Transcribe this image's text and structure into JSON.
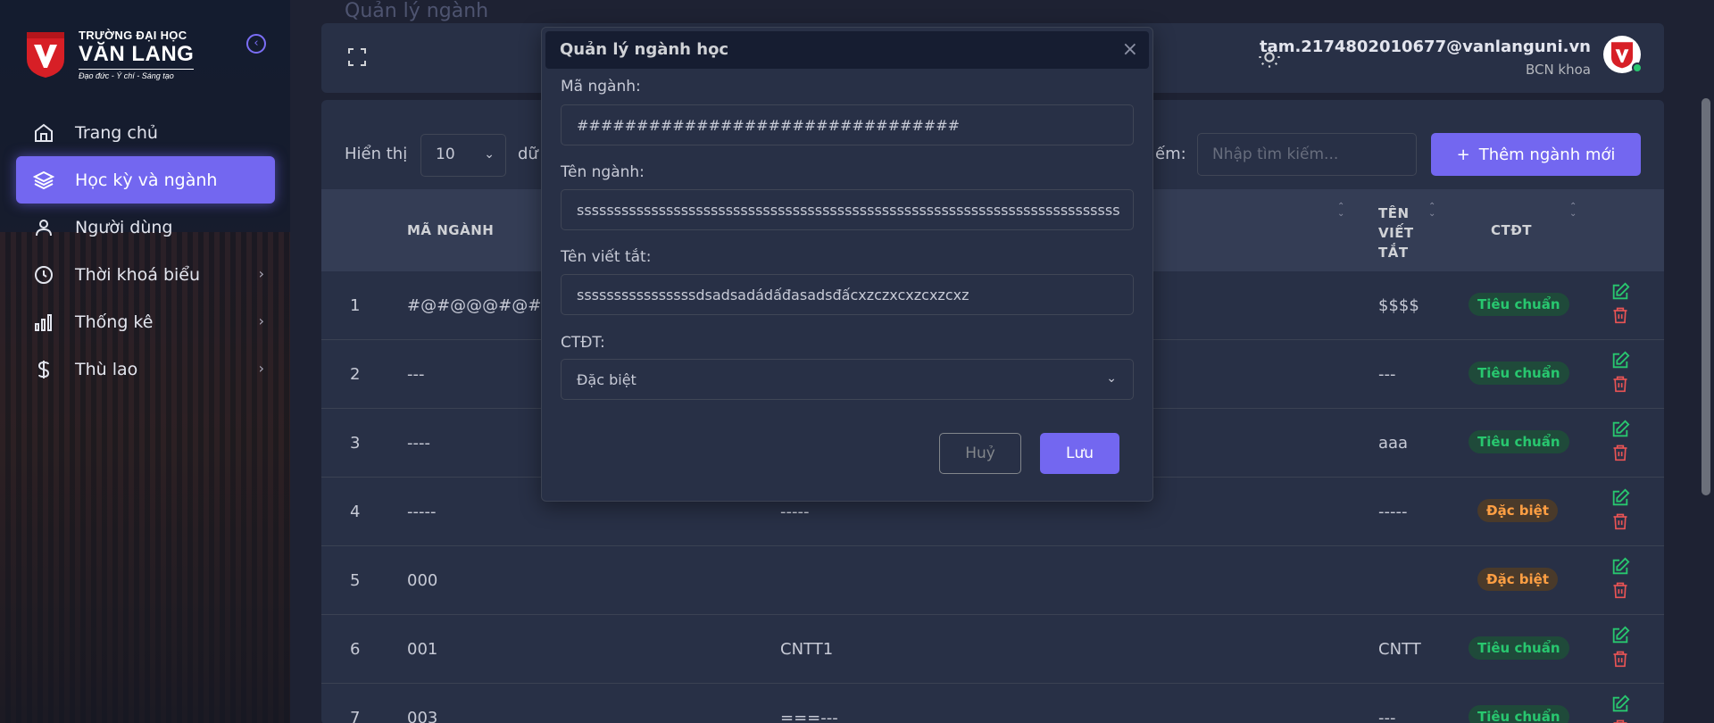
{
  "logo": {
    "line1": "TRƯỜNG ĐẠI HỌC",
    "line2": "VĂN LANG",
    "line3": "Đạo đức - Ý chí - Sáng tạo"
  },
  "sidebar": {
    "items": [
      {
        "label": "Trang chủ",
        "icon": "home-icon"
      },
      {
        "label": "Học kỳ và ngành",
        "icon": "layers-icon",
        "active": true
      },
      {
        "label": "Người dùng",
        "icon": "user-icon"
      },
      {
        "label": "Thời khoá biểu",
        "icon": "clock-icon",
        "chevron": true
      },
      {
        "label": "Thống kê",
        "icon": "bar-chart-icon",
        "chevron": true
      },
      {
        "label": "Thù lao",
        "icon": "dollar-icon",
        "chevron": true
      }
    ]
  },
  "page": {
    "heading": "Quản lý ngành"
  },
  "header": {
    "user_email": "tam.2174802010677@vanlanguni.vn",
    "user_role": "BCN khoa"
  },
  "toolbar": {
    "show_label": "Hiển thị",
    "show_value": "10",
    "show_after": "dữ",
    "search_label": "ếm:",
    "search_placeholder": "Nhập tìm kiếm...",
    "add_button": "Thêm ngành mới"
  },
  "table": {
    "columns": {
      "code": "MÃ NGÀNH",
      "abbr_1": "TÊN",
      "abbr_2": "VIẾT",
      "abbr_3": "TẮT",
      "program": "CTĐT"
    },
    "rows": [
      {
        "index": "1",
        "code": "#@#@@@#@#@",
        "name": "",
        "abbr": "$$$$",
        "program": "Tiêu chuẩn",
        "kind": "std"
      },
      {
        "index": "2",
        "code": "---",
        "name": "",
        "abbr": "---",
        "program": "Tiêu chuẩn",
        "kind": "std"
      },
      {
        "index": "3",
        "code": "----",
        "name": "",
        "abbr": "aaa",
        "program": "Tiêu chuẩn",
        "kind": "std"
      },
      {
        "index": "4",
        "code": "-----",
        "name": "-----",
        "abbr": "-----",
        "program": "Đặc biệt",
        "kind": "spc"
      },
      {
        "index": "5",
        "code": "000",
        "name": "",
        "abbr": "",
        "program": "Đặc biệt",
        "kind": "spc"
      },
      {
        "index": "6",
        "code": "001",
        "name": "CNTT1",
        "abbr": "CNTT",
        "program": "Tiêu chuẩn",
        "kind": "std"
      },
      {
        "index": "7",
        "code": "003",
        "name": "===---",
        "abbr": "---",
        "program": "Tiêu chuẩn",
        "kind": "std"
      }
    ]
  },
  "modal": {
    "title": "Quản lý ngành học",
    "code_label": "Mã ngành:",
    "code_value": "################################",
    "name_label": "Tên ngành:",
    "name_value": "sssssssssssssssssssssssssssssssssssssssssssssssssssssssssssssssssssssssss",
    "abbr_label": "Tên viết tắt:",
    "abbr_value": "ssssssssssssssssdsadsadádấđasadsđấcxzczxcxzcxzcxz",
    "program_label": "CTĐT:",
    "program_value": "Đặc biệt",
    "cancel_button": "Huỷ",
    "save_button": "Lưu"
  },
  "colors": {
    "accent": "#7367f0",
    "success": "#28c76f",
    "warning": "#ff9f43",
    "danger": "#ea5455",
    "card": "#283046"
  }
}
